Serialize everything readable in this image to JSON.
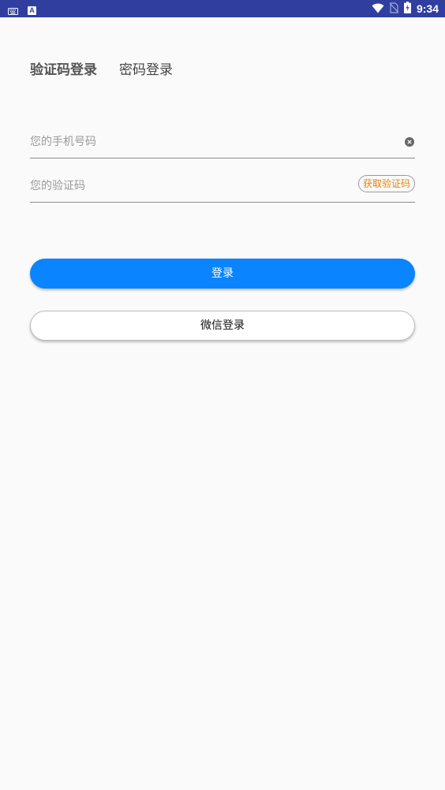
{
  "status_bar": {
    "time": "9:34",
    "left_icons": [
      "keyboard-icon",
      "a-badge-icon"
    ],
    "right_icons": [
      "wifi-icon",
      "no-sim-icon",
      "battery-charging-icon"
    ],
    "a_badge_text": "A",
    "background": "#303f9f"
  },
  "tabs": [
    {
      "label": "验证码登录",
      "active": true
    },
    {
      "label": "密码登录",
      "active": false
    }
  ],
  "phone_field": {
    "placeholder": "您的手机号码",
    "value": ""
  },
  "code_field": {
    "placeholder": "您的验证码",
    "value": "",
    "get_code_label": "获取验证码",
    "get_code_color": "#e6820e"
  },
  "login_button": {
    "label": "登录",
    "color": "#0a84ff"
  },
  "wechat_button": {
    "label": "微信登录"
  }
}
